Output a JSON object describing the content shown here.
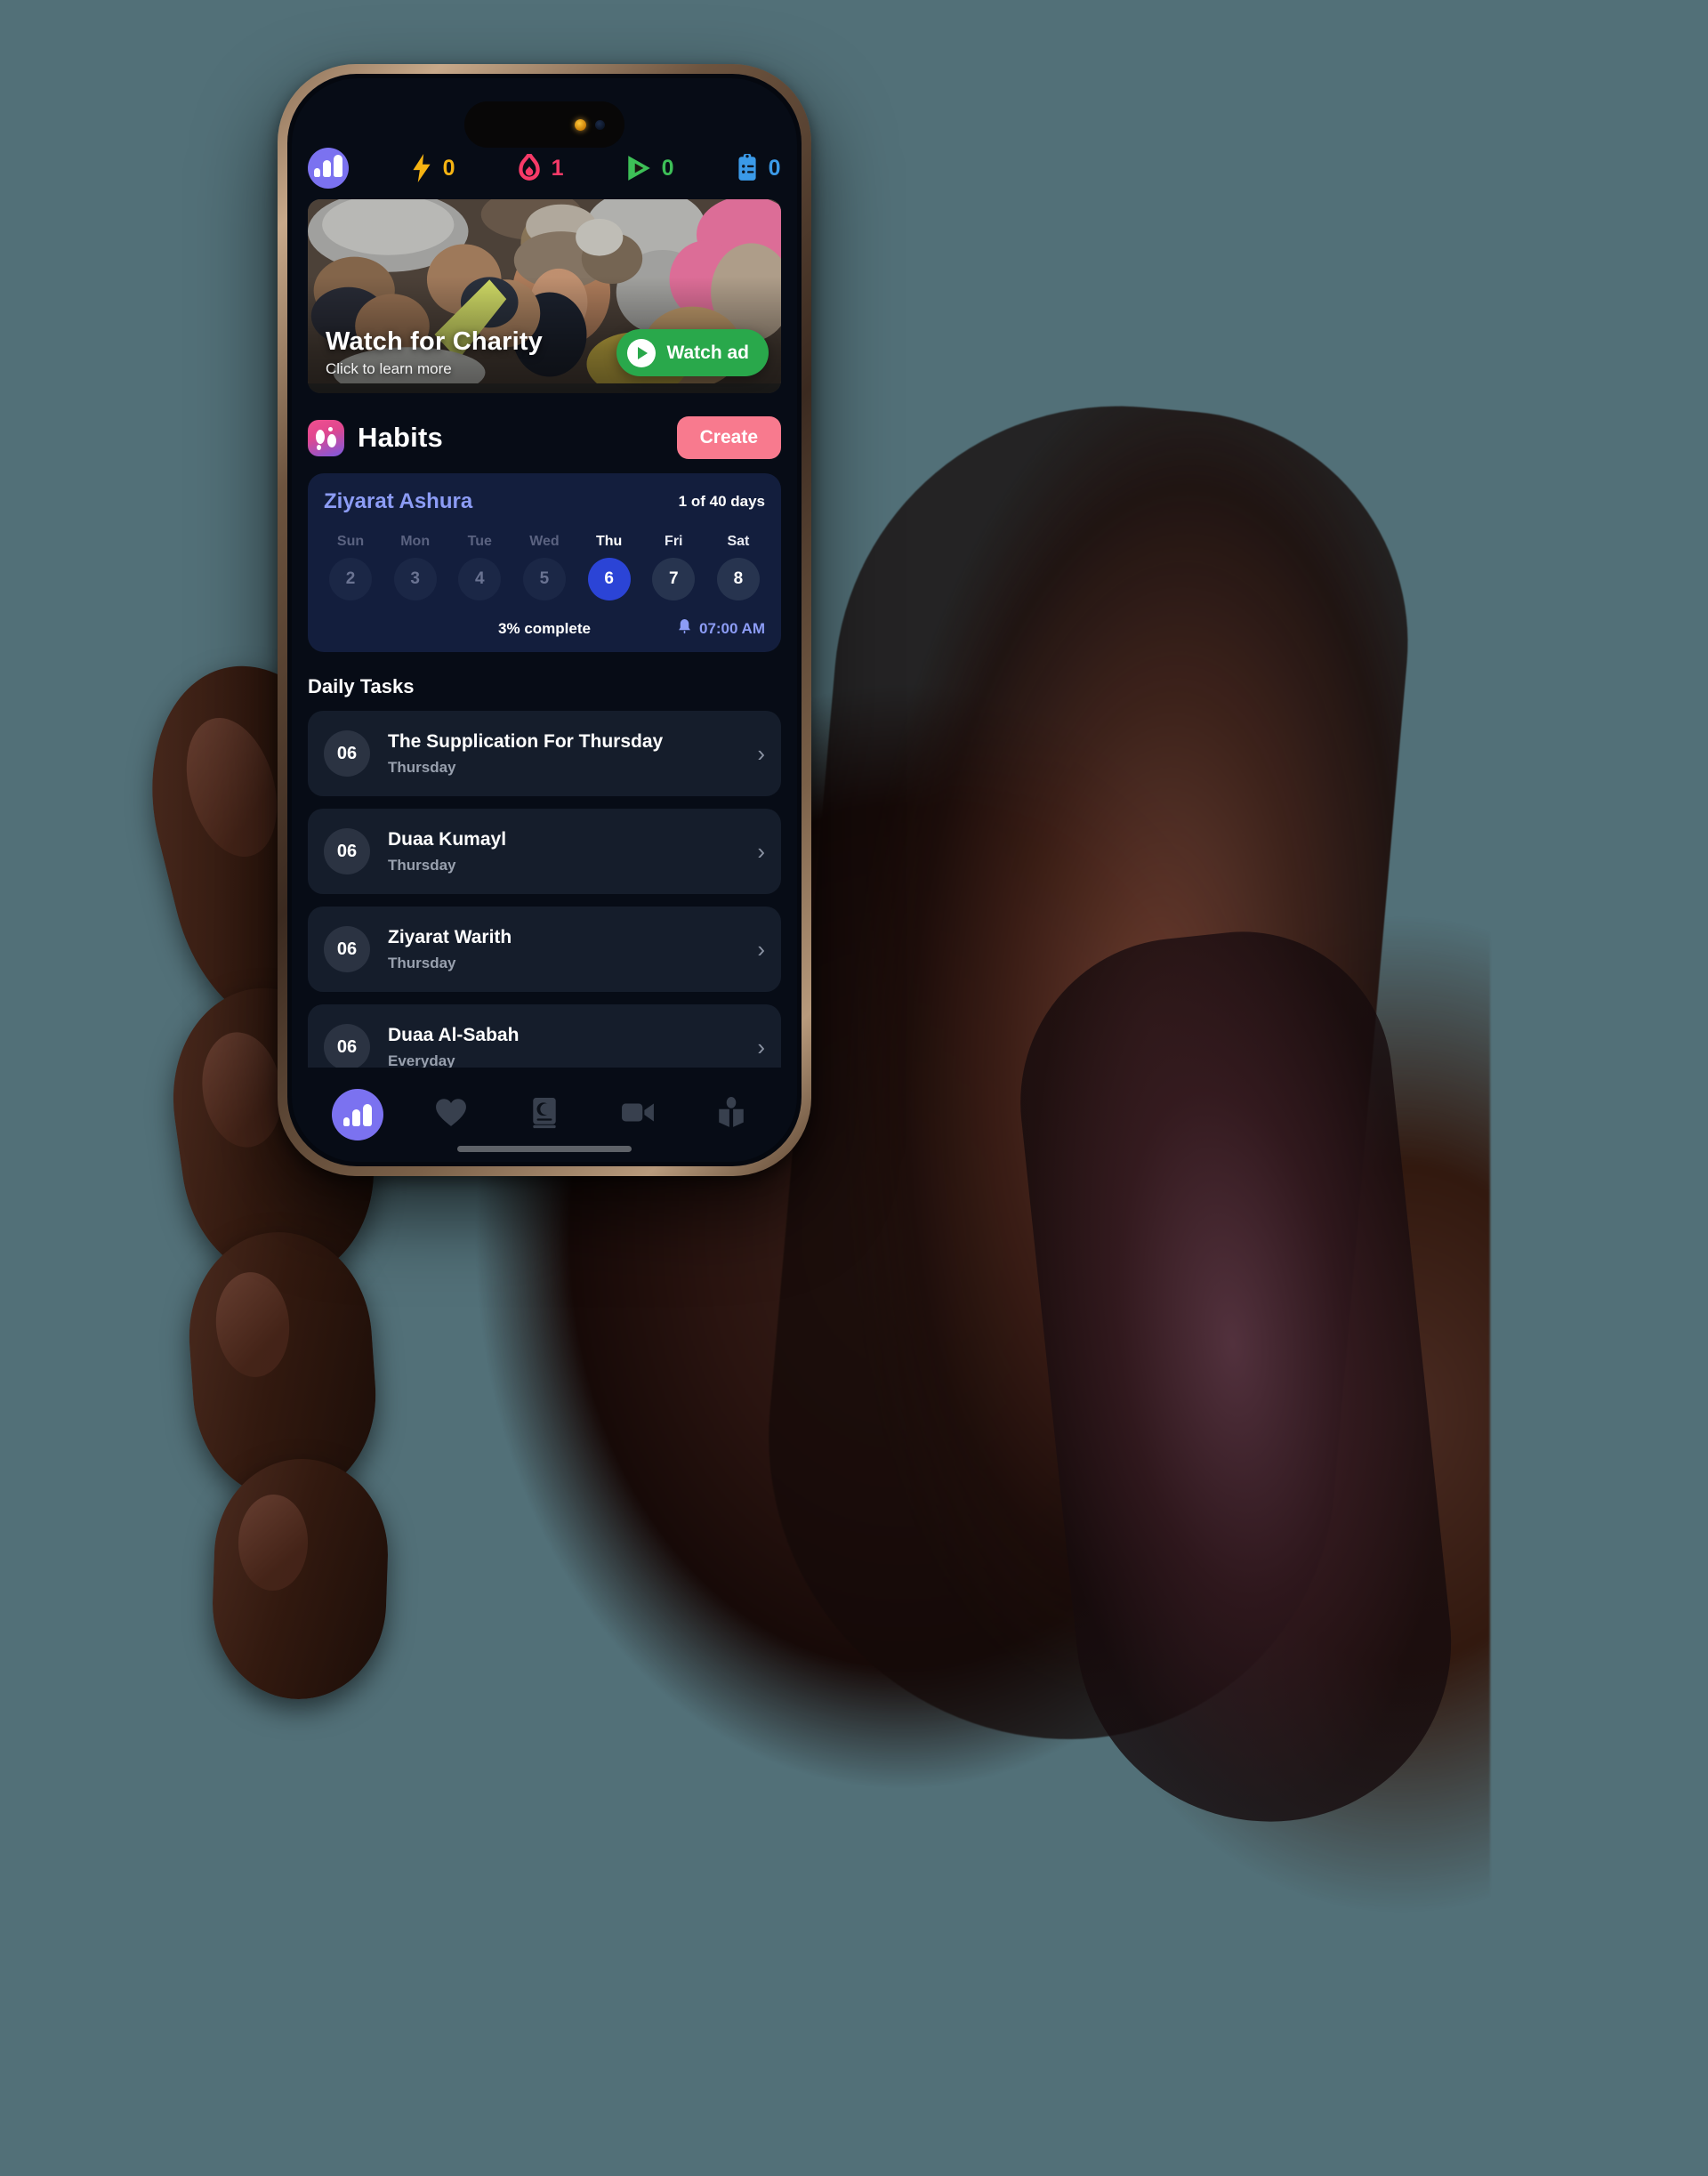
{
  "device": {
    "status_camera_indicator": "camera-active-dot"
  },
  "stats_bar": {
    "app_icon": "bar-chart-badge-icon",
    "items": [
      {
        "icon": "lightning-bolt-icon",
        "value": "0",
        "color": "#f5b312"
      },
      {
        "icon": "flame-icon",
        "value": "1",
        "color": "#f73a68"
      },
      {
        "icon": "play-triangle-icon",
        "value": "0",
        "color": "#3dbf57"
      },
      {
        "icon": "clipboard-list-icon",
        "value": "0",
        "color": "#3b9ae8"
      }
    ]
  },
  "banner": {
    "title": "Watch for Charity",
    "subtitle": "Click to learn more",
    "button_label": "Watch ad",
    "button_icon": "play-circle-icon",
    "button_color": "#29a84b"
  },
  "habits_section": {
    "icon": "footprints-icon",
    "title": "Habits",
    "create_label": "Create",
    "create_color": "#f87a8e",
    "card": {
      "name": "Ziyarat Ashura",
      "name_color": "#8c9cf5",
      "progress_label": "1 of 40 days",
      "week": [
        {
          "day": "Sun",
          "date": "2",
          "state": "past"
        },
        {
          "day": "Mon",
          "date": "3",
          "state": "past"
        },
        {
          "day": "Tue",
          "date": "4",
          "state": "past"
        },
        {
          "day": "Wed",
          "date": "5",
          "state": "past"
        },
        {
          "day": "Thu",
          "date": "6",
          "state": "active"
        },
        {
          "day": "Fri",
          "date": "7",
          "state": "upcoming"
        },
        {
          "day": "Sat",
          "date": "8",
          "state": "upcoming"
        }
      ],
      "percent_label": "3% complete",
      "reminder_icon": "bell-icon",
      "reminder_time": "07:00 AM",
      "active_color": "#2b44d6"
    }
  },
  "daily_tasks": {
    "heading": "Daily Tasks",
    "items": [
      {
        "num": "06",
        "title": "The Supplication For Thursday",
        "subtitle": "Thursday",
        "chevron": "chevron-right-icon"
      },
      {
        "num": "06",
        "title": "Duaa Kumayl",
        "subtitle": "Thursday",
        "chevron": "chevron-right-icon"
      },
      {
        "num": "06",
        "title": "Ziyarat Warith",
        "subtitle": "Thursday",
        "chevron": "chevron-right-icon"
      },
      {
        "num": "06",
        "title": "Duaa Al-Sabah",
        "subtitle": "Everyday",
        "chevron": "chevron-right-icon"
      }
    ]
  },
  "bottom_nav": {
    "items": [
      {
        "icon": "bar-chart-icon",
        "active": true
      },
      {
        "icon": "heart-icon",
        "active": false
      },
      {
        "icon": "quran-book-icon",
        "active": false
      },
      {
        "icon": "video-camera-icon",
        "active": false
      },
      {
        "icon": "open-book-icon",
        "active": false
      }
    ],
    "active_color": "#7b72f0",
    "inactive_color": "#38404e"
  }
}
